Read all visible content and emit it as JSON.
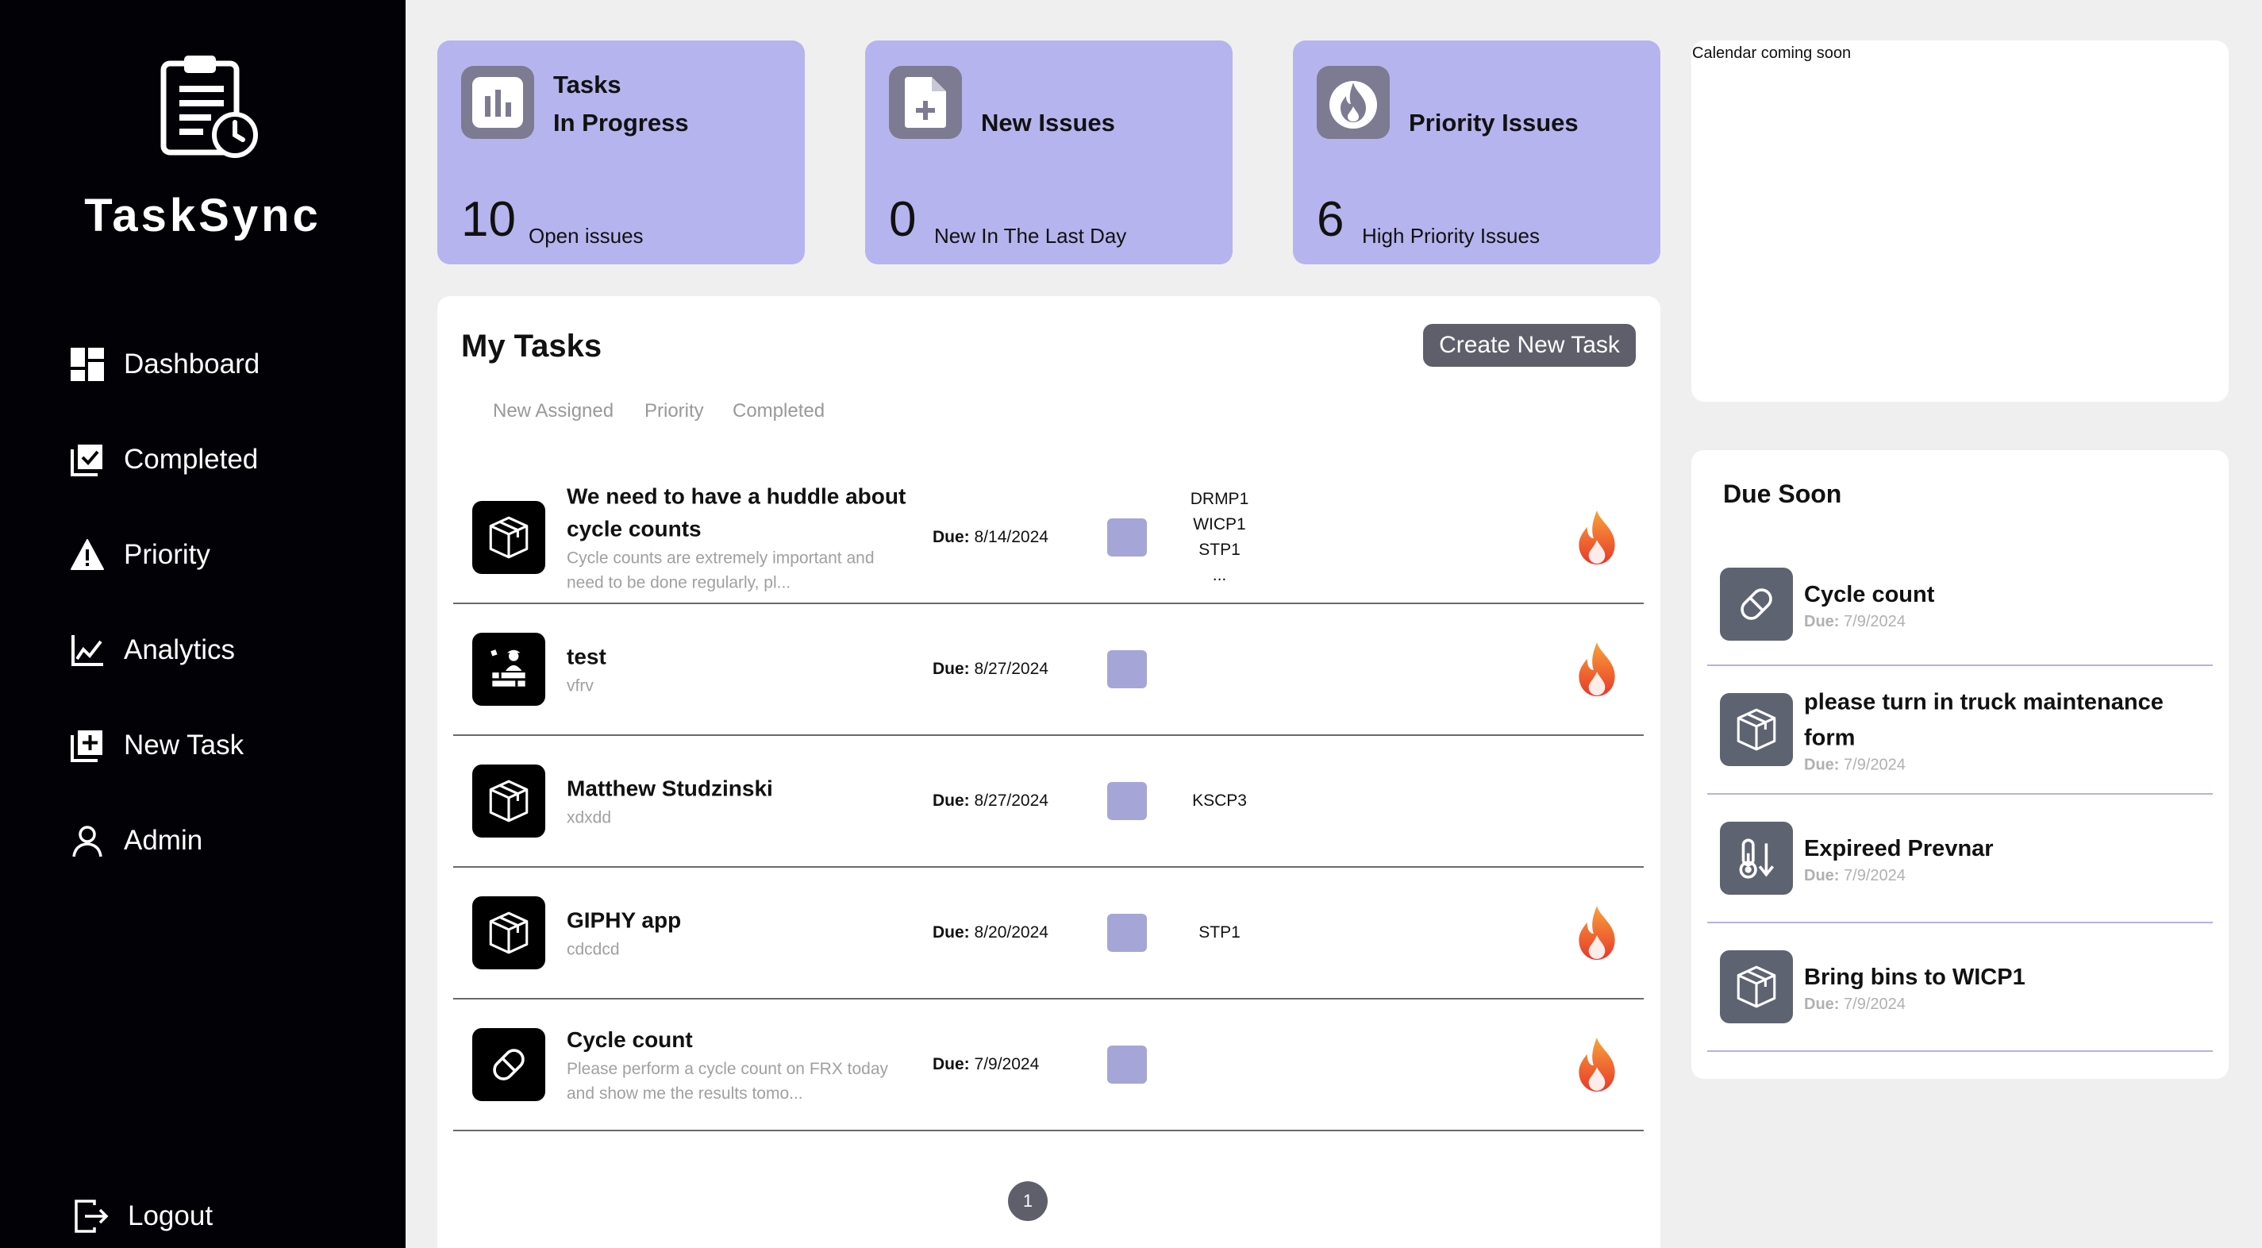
{
  "app": {
    "brand": "TaskSync"
  },
  "sidebar": {
    "items": [
      {
        "label": "Dashboard",
        "icon": "dashboard-icon"
      },
      {
        "label": "Completed",
        "icon": "completed-icon"
      },
      {
        "label": "Priority",
        "icon": "warning-icon"
      },
      {
        "label": "Analytics",
        "icon": "analytics-icon"
      },
      {
        "label": "New Task",
        "icon": "add-task-icon"
      },
      {
        "label": "Admin",
        "icon": "user-icon"
      }
    ],
    "logout": "Logout"
  },
  "stats": [
    {
      "title_line1": "Tasks",
      "title_line2": "In Progress",
      "value": "10",
      "caption": "Open issues",
      "icon": "bar-chart-icon"
    },
    {
      "title_line1": "New Issues",
      "value": "0",
      "caption": "New In The Last Day",
      "icon": "new-file-icon"
    },
    {
      "title_line1": "Priority Issues",
      "value": "6",
      "caption": "High Priority Issues",
      "icon": "flame-icon"
    }
  ],
  "calendar": {
    "text": "Calendar coming soon"
  },
  "tasks": {
    "title": "My Tasks",
    "create_label": "Create New Task",
    "tabs": [
      "New Assigned",
      "Priority",
      "Completed"
    ],
    "rows": [
      {
        "title": "We need to have a huddle about cycle counts",
        "desc": "Cycle counts are extremely important and need to be done regularly, pl...",
        "due_label": "Due:",
        "due": "8/14/2024",
        "locations": [
          "DRMP1",
          "WICP1",
          "STP1",
          "..."
        ],
        "priority": true,
        "icon": "box-icon"
      },
      {
        "title": "test",
        "desc": "vfrv",
        "due_label": "Due:",
        "due": "8/27/2024",
        "locations": [],
        "priority": true,
        "icon": "workers-icon"
      },
      {
        "title": "Matthew Studzinski",
        "desc": "xdxdd",
        "due_label": "Due:",
        "due": "8/27/2024",
        "locations": [
          "KSCP3"
        ],
        "priority": false,
        "icon": "box-icon"
      },
      {
        "title": "GIPHY app",
        "desc": "cdcdcd",
        "due_label": "Due:",
        "due": "8/20/2024",
        "locations": [
          "STP1"
        ],
        "priority": true,
        "icon": "box-icon"
      },
      {
        "title": "Cycle count",
        "desc": "Please perform a cycle count on FRX today and show me the results tomo...",
        "due_label": "Due:",
        "due": "7/9/2024",
        "locations": [],
        "priority": true,
        "icon": "pill-icon"
      }
    ],
    "page": "1"
  },
  "due_soon": {
    "title": "Due Soon",
    "items": [
      {
        "name": "Cycle count",
        "due_label": "Due:",
        "due": "7/9/2024",
        "icon": "pill-icon"
      },
      {
        "name": "please turn in truck maintenance form",
        "due_label": "Due:",
        "due": "7/9/2024",
        "icon": "box-icon"
      },
      {
        "name": "Expireed Prevnar",
        "due_label": "Due:",
        "due": "7/9/2024",
        "icon": "thermometer-icon"
      },
      {
        "name": "Bring bins to WICP1",
        "due_label": "Due:",
        "due": "7/9/2024",
        "icon": "box-icon"
      }
    ]
  },
  "colors": {
    "sidebar": "#020106",
    "card": "#b5b4ee",
    "accent": "#a6a5d8",
    "button": "#5e5f6a",
    "flame": "#f0562a"
  }
}
